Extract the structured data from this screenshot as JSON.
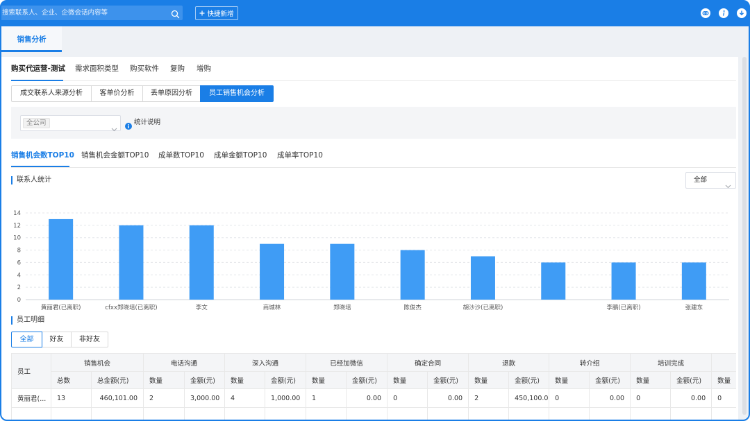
{
  "topbar": {
    "search_placeholder": "搜索联系人、企业、企微会话内容等",
    "quick_add_label": "快捷新增",
    "icons": [
      "search-icon",
      "plus-icon",
      "link-icon",
      "info-icon",
      "download-icon"
    ]
  },
  "page_tabs": [
    {
      "label": "销售分析",
      "active": true
    }
  ],
  "sub_tabs": [
    {
      "label": "购买代运营-测试",
      "active": true
    },
    {
      "label": "需求面积类型",
      "active": false
    },
    {
      "label": "购买软件",
      "active": false
    },
    {
      "label": "复购",
      "active": false
    },
    {
      "label": "增购",
      "active": false
    }
  ],
  "analysis_segments": [
    {
      "label": "成交联系人来源分析",
      "active": false
    },
    {
      "label": "客单价分析",
      "active": false
    },
    {
      "label": "丢单原因分析",
      "active": false
    },
    {
      "label": "员工销售机会分析",
      "active": true
    }
  ],
  "filter": {
    "company_tag": "全公司",
    "help_label": "统计说明"
  },
  "rank_tabs": [
    {
      "label": "销售机会数TOP10",
      "active": true
    },
    {
      "label": "销售机会金额TOP10",
      "active": false
    },
    {
      "label": "成单数TOP10",
      "active": false
    },
    {
      "label": "成单金额TOP10",
      "active": false
    },
    {
      "label": "成单率TOP10",
      "active": false
    }
  ],
  "contact_stats": {
    "title": "联系人统计",
    "range_select_value": "全部"
  },
  "employee_detail": {
    "title": "员工明细",
    "filter_buttons": [
      "全部",
      "好友",
      "非好友"
    ],
    "active_filter": "全部"
  },
  "table": {
    "employee_header": "员工",
    "groups": [
      "销售机会",
      "电话沟通",
      "深入沟通",
      "已经加微信",
      "确定合同",
      "退款",
      "转介绍",
      "培训完成"
    ],
    "sub_headers": [
      "总数",
      "总金额(元)",
      "数量",
      "金额(元)",
      "数量",
      "金额(元)",
      "数量",
      "金额(元)",
      "数量",
      "金额(元)",
      "数量",
      "金额(元)",
      "数量",
      "金额(元)",
      "数量",
      "金额(元)",
      "数量"
    ],
    "rows": [
      [
        "黄丽君(...",
        "13",
        "460,101.00",
        "2",
        "3,000.00",
        "4",
        "1,000.00",
        "1",
        "0.00",
        "0",
        "0.00",
        "2",
        "450,100.00",
        "0",
        "0.00",
        "0",
        "0.00",
        "0"
      ]
    ]
  },
  "colors": {
    "primary": "#1a7ee6",
    "bar": "#3f9cf5",
    "header_bg": "#f4f5f7",
    "page_bg": "#eef1f5"
  },
  "chart_data": {
    "type": "bar",
    "categories": [
      "黄丽君(已离职)",
      "cfxx郑晓培(已离职)",
      "李文",
      "商城林",
      "郑晓培",
      "陈俊杰",
      "胡沙沙(已离职)",
      "",
      "李鹏(已离职)",
      "张建东"
    ],
    "values": [
      13,
      12,
      12,
      9,
      9,
      8,
      7,
      6,
      6,
      6
    ],
    "ylim": [
      0,
      14
    ],
    "yticks": [
      0,
      2,
      4,
      6,
      8,
      10,
      12,
      14
    ],
    "grid": true,
    "legend": false
  }
}
